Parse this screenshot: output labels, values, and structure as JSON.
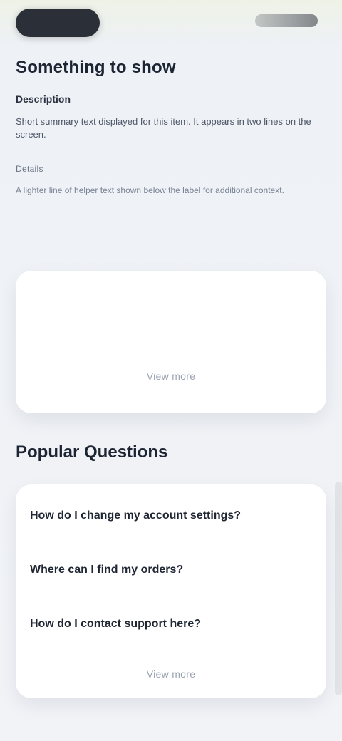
{
  "sec1": {
    "title": "Something to show",
    "subtitle": "Description",
    "description": "Short summary text displayed for this item. It appears in two lines on the screen.",
    "meta_label": "Details",
    "meta_description": "A lighter line of helper text shown below the label for additional context.",
    "card_cta": "View more"
  },
  "sec2": {
    "title": "Popular Questions",
    "items": [
      "How do I change my account settings?",
      "Where can I find my orders?",
      "How do I contact support here?"
    ],
    "card_cta": "View more"
  }
}
